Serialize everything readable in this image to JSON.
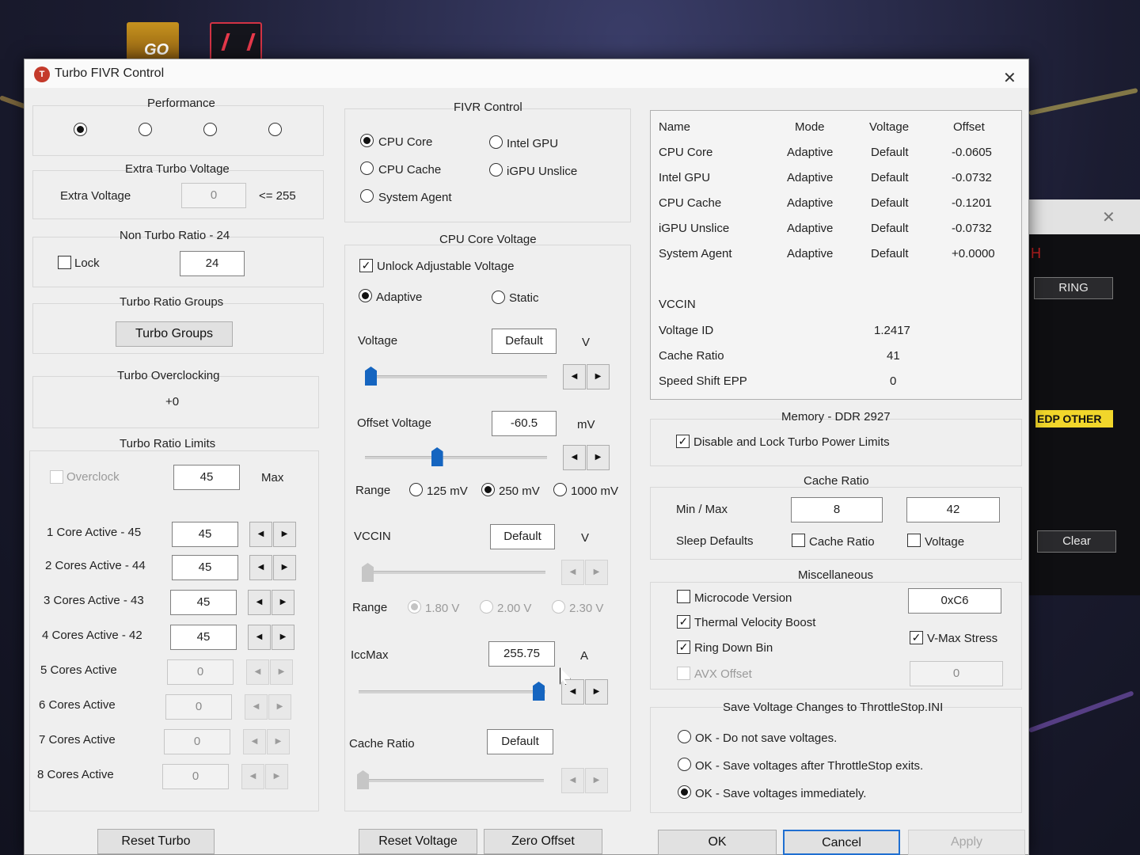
{
  "desktop": {
    "icon_go_label": "GO",
    "bg_window_h": "H",
    "bg_ring_label": "RING",
    "bg_edp_label": "EDP OTHER",
    "bg_clear_label": "Clear"
  },
  "window": {
    "title": "Turbo FIVR Control"
  },
  "performance": {
    "title": "Performance",
    "selected_index": 0
  },
  "extra_turbo": {
    "title": "Extra Turbo Voltage",
    "label": "Extra Voltage",
    "value": "0",
    "limit": "<= 255"
  },
  "non_turbo": {
    "title": "Non Turbo Ratio - 24",
    "lock_label": "Lock",
    "value": "24"
  },
  "turbo_groups": {
    "title": "Turbo Ratio Groups",
    "button": "Turbo Groups"
  },
  "turbo_oc": {
    "title": "Turbo Overclocking",
    "value": "+0"
  },
  "turbo_limits": {
    "title": "Turbo Ratio Limits",
    "overclock_label": "Overclock",
    "overclock_value": "45",
    "max_label": "Max",
    "rows": [
      {
        "label": "1 Core  Active - 45",
        "value": "45"
      },
      {
        "label": "2 Cores Active - 44",
        "value": "45"
      },
      {
        "label": "3 Cores Active - 43",
        "value": "45"
      },
      {
        "label": "4 Cores Active - 42",
        "value": "45"
      },
      {
        "label": "5 Cores Active",
        "value": "0"
      },
      {
        "label": "6 Cores Active",
        "value": "0"
      },
      {
        "label": "7 Cores Active",
        "value": "0"
      },
      {
        "label": "8 Cores Active",
        "value": "0"
      }
    ]
  },
  "fivr_control": {
    "title": "FIVR Control",
    "options": [
      "CPU Core",
      "Intel GPU",
      "CPU Cache",
      "iGPU Unslice",
      "System Agent"
    ],
    "selected": "CPU Core"
  },
  "cpu_core_voltage": {
    "title": "CPU Core Voltage",
    "unlock_label": "Unlock Adjustable Voltage",
    "unlock_checked": true,
    "mode_adaptive": "Adaptive",
    "mode_static": "Static",
    "voltage_label": "Voltage",
    "voltage_value": "Default",
    "voltage_unit": "V",
    "voltage_slider": 0.0,
    "offset_label": "Offset Voltage",
    "offset_value": "-60.5",
    "offset_unit": "mV",
    "offset_slider": 0.38,
    "range_label": "Range",
    "range_options": [
      "125 mV",
      "250 mV",
      "1000 mV"
    ],
    "range_selected": "250 mV",
    "vccin_label": "VCCIN",
    "vccin_value": "Default",
    "vccin_unit": "V",
    "vccin_range_options": [
      "1.80 V",
      "2.00 V",
      "2.30 V"
    ],
    "iccmax_label": "IccMax",
    "iccmax_value": "255.75",
    "iccmax_unit": "A",
    "iccmax_slider": 1.0,
    "cache_ratio_label": "Cache Ratio",
    "cache_ratio_value": "Default"
  },
  "status_table": {
    "headers": [
      "Name",
      "Mode",
      "Voltage",
      "Offset"
    ],
    "rows": [
      {
        "name": "CPU Core",
        "mode": "Adaptive",
        "voltage": "Default",
        "offset": "-0.0605"
      },
      {
        "name": "Intel GPU",
        "mode": "Adaptive",
        "voltage": "Default",
        "offset": "-0.0732"
      },
      {
        "name": "CPU Cache",
        "mode": "Adaptive",
        "voltage": "Default",
        "offset": "-0.1201"
      },
      {
        "name": "iGPU Unslice",
        "mode": "Adaptive",
        "voltage": "Default",
        "offset": "-0.0732"
      },
      {
        "name": "System Agent",
        "mode": "Adaptive",
        "voltage": "Default",
        "offset": "+0.0000"
      }
    ],
    "vccin_label": "VCCIN",
    "voltage_id_label": "Voltage ID",
    "voltage_id_value": "1.2417",
    "cache_ratio_label": "Cache Ratio",
    "cache_ratio_value": "41",
    "speed_shift_label": "Speed Shift EPP",
    "speed_shift_value": "0"
  },
  "memory": {
    "title": "Memory - DDR 2927",
    "disable_lock_label": "Disable and Lock Turbo Power Limits",
    "disable_lock_checked": true
  },
  "cache_ratio": {
    "title": "Cache Ratio",
    "minmax_label": "Min / Max",
    "min_value": "8",
    "max_value": "42",
    "sleep_label": "Sleep Defaults",
    "sleep_cache_label": "Cache Ratio",
    "sleep_voltage_label": "Voltage"
  },
  "misc": {
    "title": "Miscellaneous",
    "microcode_label": "Microcode Version",
    "microcode_value": "0xC6",
    "tvb_label": "Thermal Velocity Boost",
    "vmax_label": "V-Max Stress",
    "ringdown_label": "Ring Down Bin",
    "avx_label": "AVX Offset",
    "avx_value": "0"
  },
  "save": {
    "title": "Save Voltage Changes to ThrottleStop.INI",
    "options": [
      "OK - Do not save voltages.",
      "OK - Save voltages after ThrottleStop exits.",
      "OK - Save voltages immediately."
    ],
    "selected_index": 2
  },
  "buttons": {
    "reset_turbo": "Reset Turbo",
    "reset_voltage": "Reset Voltage",
    "zero_offset": "Zero Offset",
    "ok": "OK",
    "cancel": "Cancel",
    "apply": "Apply"
  },
  "colors": {
    "accent": "#1565c0",
    "window_bg": "#efefef",
    "edp_yellow": "#f1d62b"
  }
}
